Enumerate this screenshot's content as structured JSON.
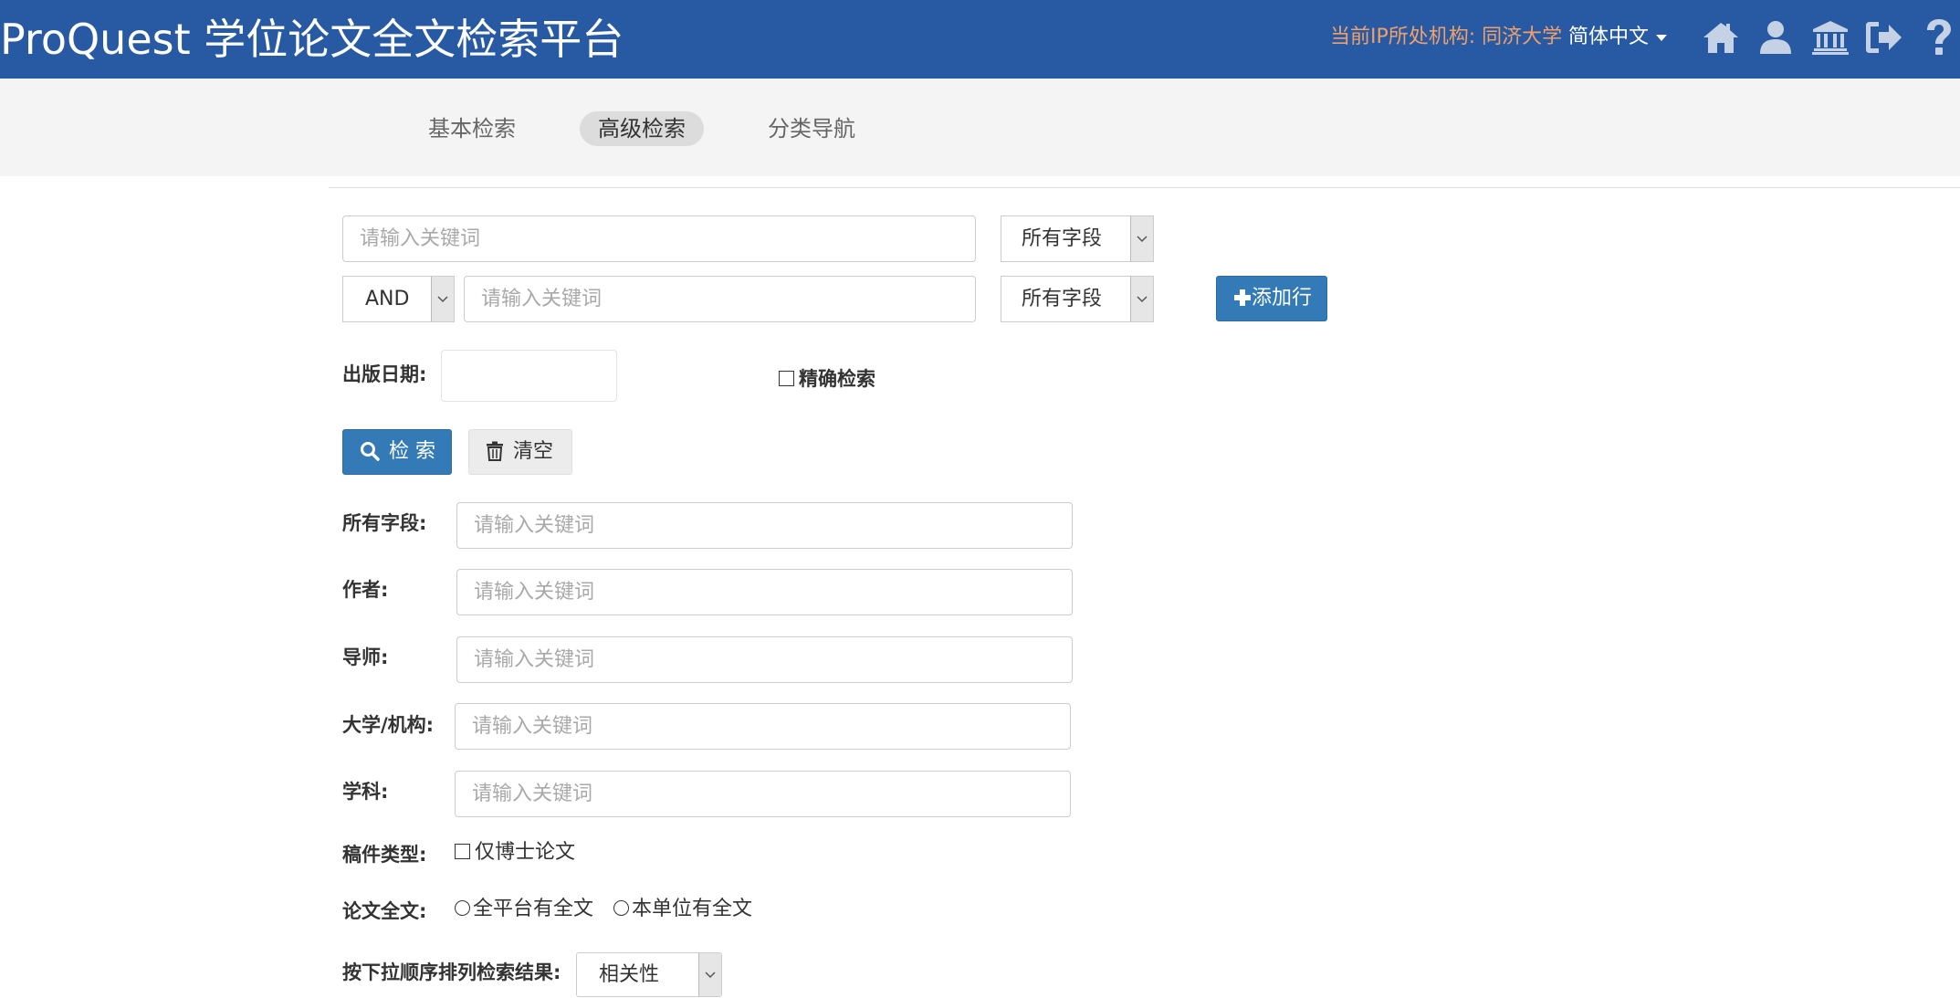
{
  "header": {
    "title": "ProQuest 学位论文全文检索平台",
    "ip_info": "当前IP所处机构: 同济大学",
    "language": "简体中文",
    "icons": [
      "home-icon",
      "user-icon",
      "institution-icon",
      "logout-icon",
      "help-icon"
    ]
  },
  "tabs": [
    {
      "label": "基本检索",
      "active": false
    },
    {
      "label": "高级检索",
      "active": true
    },
    {
      "label": "分类导航",
      "active": false
    }
  ],
  "search_rows": {
    "row1": {
      "placeholder": "请输入关键词",
      "field": "所有字段"
    },
    "row2": {
      "operator": "AND",
      "placeholder": "请输入关键词",
      "field": "所有字段"
    },
    "add_row_label": "添加行"
  },
  "date": {
    "label": "出版日期:",
    "value": ""
  },
  "exact_search": {
    "label": "精确检索",
    "checked": false
  },
  "buttons": {
    "search": "检 索",
    "clear": "清空"
  },
  "fields": [
    {
      "label": "所有字段:",
      "placeholder": "请输入关键词"
    },
    {
      "label": "作者:",
      "placeholder": "请输入关键词"
    },
    {
      "label": "导师:",
      "placeholder": "请输入关键词"
    },
    {
      "label": "大学/机构:",
      "placeholder": "请输入关键词"
    },
    {
      "label": "学科:",
      "placeholder": "请输入关键词"
    }
  ],
  "manuscript_type": {
    "label": "稿件类型:",
    "option": "仅博士论文",
    "checked": false
  },
  "fulltext": {
    "label": "论文全文:",
    "options": [
      "全平台有全文",
      "本单位有全文"
    ]
  },
  "sort": {
    "label": "按下拉顺序排列检索结果:",
    "value": "相关性"
  },
  "colors": {
    "header_bg": "#275aa2",
    "ip_text": "#f0a06a",
    "primary": "#337ab7",
    "tab_bg": "#f4f4f4",
    "icon": "#c5d2e6"
  }
}
